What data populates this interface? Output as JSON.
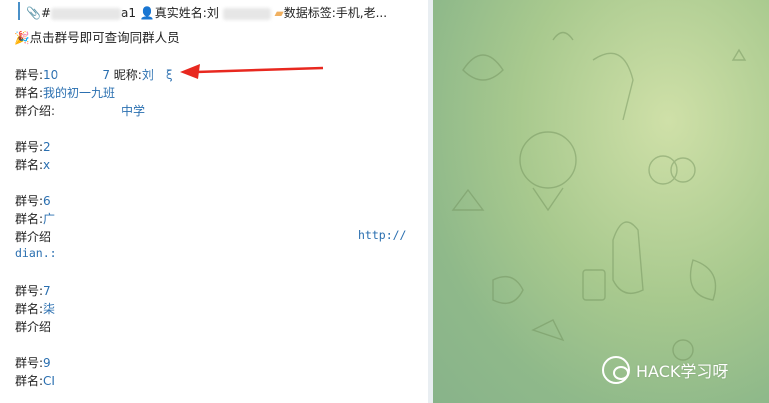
{
  "header": {
    "paperclip_icon": "paperclip-icon",
    "prefix": "#",
    "suffix": "a1",
    "realname_icon": "person-icon",
    "realname_label": "真实姓名:刘",
    "tag_icon": "tag-icon",
    "tag_label": "数据标签:手机,老..."
  },
  "hint": {
    "icon": "party-popper-icon",
    "text": "点击群号即可查询同群人员"
  },
  "groups": [
    {
      "id_label": "群号:",
      "id_value": "10",
      "id_value2": "7",
      "nick_label": "昵称:",
      "nick_value": "刘",
      "nick_tail": "ξ",
      "name_label": "群名:",
      "name_value": "我的初一九班",
      "intro_label": "群介绍:",
      "intro_value": "中学"
    },
    {
      "id_label": "群号:",
      "id_value": "2",
      "name_label": "群名:",
      "name_value": "x"
    },
    {
      "id_label": "群号:",
      "id_value": "6",
      "name_label": "群名:",
      "name_value": "广",
      "intro_label": "群介绍",
      "intro_link1": "http://",
      "intro_link2": "dian.:"
    },
    {
      "id_label": "群号:",
      "id_value": "7",
      "name_label": "群名:",
      "name_value": "柒",
      "intro_label": "群介绍"
    },
    {
      "id_label": "群号:",
      "id_value": "9",
      "name_label": "群名:",
      "name_value": "CI"
    }
  ],
  "watermark": {
    "icon": "wechat-icon",
    "text": "HACK学习呀"
  },
  "colors": {
    "link": "#2a6fb0",
    "arrow": "#e8281f",
    "quote_bar": "#4a90c8"
  }
}
